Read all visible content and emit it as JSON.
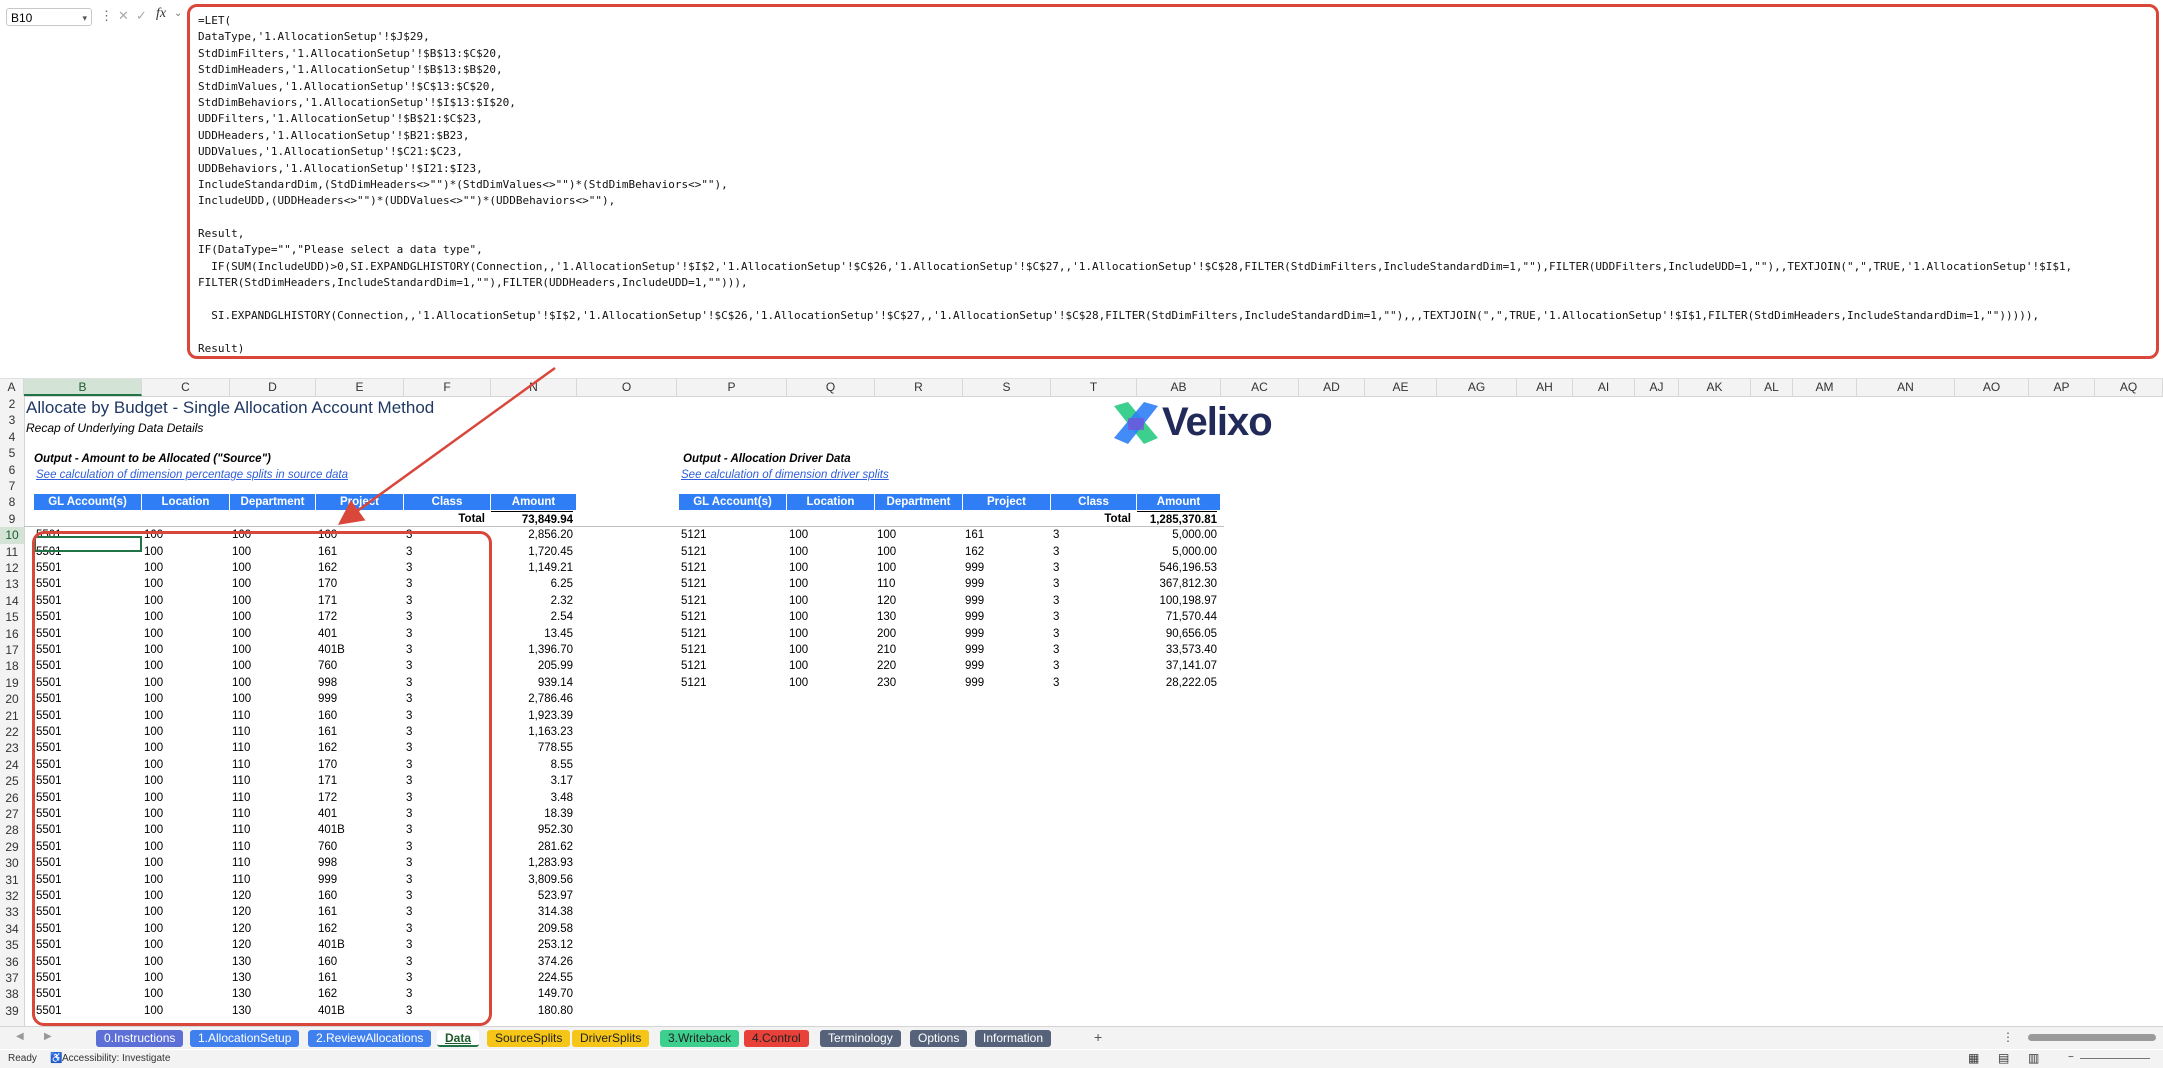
{
  "formula_bar": {
    "name_box": "B10",
    "formula_lines": [
      "=LET(",
      "DataType,'1.AllocationSetup'!$J$29,",
      "StdDimFilters,'1.AllocationSetup'!$B$13:$C$20,",
      "StdDimHeaders,'1.AllocationSetup'!$B$13:$B$20,",
      "StdDimValues,'1.AllocationSetup'!$C$13:$C$20,",
      "StdDimBehaviors,'1.AllocationSetup'!$I$13:$I$20,",
      "UDDFilters,'1.AllocationSetup'!$B$21:$C$23,",
      "UDDHeaders,'1.AllocationSetup'!$B21:$B23,",
      "UDDValues,'1.AllocationSetup'!$C21:$C23,",
      "UDDBehaviors,'1.AllocationSetup'!$I21:$I23,",
      "IncludeStandardDim,(StdDimHeaders<>\"\")*(StdDimValues<>\"\")*(StdDimBehaviors<>\"\"),",
      "IncludeUDD,(UDDHeaders<>\"\")*(UDDValues<>\"\")*(UDDBehaviors<>\"\"),",
      "",
      "Result,",
      "IF(DataType=\"\",\"Please select a data type\",",
      "  IF(SUM(IncludeUDD)>0,SI.EXPANDGLHISTORY(Connection,,'1.AllocationSetup'!$I$2,'1.AllocationSetup'!$C$26,'1.AllocationSetup'!$C$27,,'1.AllocationSetup'!$C$28,FILTER(StdDimFilters,IncludeStandardDim=1,\"\"),FILTER(UDDFilters,IncludeUDD=1,\"\"),,TEXTJOIN(\",\",TRUE,'1.AllocationSetup'!$I$1,",
      "FILTER(StdDimHeaders,IncludeStandardDim=1,\"\"),FILTER(UDDHeaders,IncludeUDD=1,\"\"))),",
      "",
      "  SI.EXPANDGLHISTORY(Connection,,'1.AllocationSetup'!$I$2,'1.AllocationSetup'!$C$26,'1.AllocationSetup'!$C$27,,'1.AllocationSetup'!$C$28,FILTER(StdDimFilters,IncludeStandardDim=1,\"\"),,,TEXTJOIN(\",\",TRUE,'1.AllocationSetup'!$I$1,FILTER(StdDimHeaders,IncludeStandardDim=1,\"\"))))),",
      "",
      "Result)"
    ]
  },
  "columns": [
    "A",
    "B",
    "C",
    "D",
    "E",
    "F",
    "N",
    "O",
    "P",
    "Q",
    "R",
    "S",
    "T",
    "AB",
    "AC",
    "AD",
    "AE",
    "AG",
    "AH",
    "AI",
    "AJ",
    "AK",
    "AL",
    "AM",
    "AN",
    "AO",
    "AP",
    "AQ"
  ],
  "rows": [
    "2",
    "3",
    "4",
    "5",
    "6",
    "7",
    "8",
    "9",
    "10",
    "11",
    "12",
    "13",
    "14",
    "15",
    "16",
    "17",
    "18",
    "19",
    "20",
    "21",
    "22",
    "23",
    "24",
    "25",
    "26",
    "27",
    "28",
    "29",
    "30",
    "31",
    "32",
    "33",
    "34",
    "35",
    "36",
    "37",
    "38",
    "39"
  ],
  "sheet": {
    "title": "Allocate by Budget - Single Allocation Account Method",
    "subtitle": "Recap of Underlying Data Details",
    "logo_text": "Velixo",
    "source": {
      "section_title": "Output - Amount to be Allocated (\"Source\")",
      "link": "See calculation of dimension percentage splits in source data",
      "headers": [
        "GL Account(s)",
        "Location",
        "Department",
        "Project",
        "Class",
        "Amount"
      ],
      "total_label": "Total",
      "total_value": "73,849.94",
      "rows": [
        [
          "5501",
          "100",
          "100",
          "160",
          "3",
          "2,856.20"
        ],
        [
          "5501",
          "100",
          "100",
          "161",
          "3",
          "1,720.45"
        ],
        [
          "5501",
          "100",
          "100",
          "162",
          "3",
          "1,149.21"
        ],
        [
          "5501",
          "100",
          "100",
          "170",
          "3",
          "6.25"
        ],
        [
          "5501",
          "100",
          "100",
          "171",
          "3",
          "2.32"
        ],
        [
          "5501",
          "100",
          "100",
          "172",
          "3",
          "2.54"
        ],
        [
          "5501",
          "100",
          "100",
          "401",
          "3",
          "13.45"
        ],
        [
          "5501",
          "100",
          "100",
          "401B",
          "3",
          "1,396.70"
        ],
        [
          "5501",
          "100",
          "100",
          "760",
          "3",
          "205.99"
        ],
        [
          "5501",
          "100",
          "100",
          "998",
          "3",
          "939.14"
        ],
        [
          "5501",
          "100",
          "100",
          "999",
          "3",
          "2,786.46"
        ],
        [
          "5501",
          "100",
          "110",
          "160",
          "3",
          "1,923.39"
        ],
        [
          "5501",
          "100",
          "110",
          "161",
          "3",
          "1,163.23"
        ],
        [
          "5501",
          "100",
          "110",
          "162",
          "3",
          "778.55"
        ],
        [
          "5501",
          "100",
          "110",
          "170",
          "3",
          "8.55"
        ],
        [
          "5501",
          "100",
          "110",
          "171",
          "3",
          "3.17"
        ],
        [
          "5501",
          "100",
          "110",
          "172",
          "3",
          "3.48"
        ],
        [
          "5501",
          "100",
          "110",
          "401",
          "3",
          "18.39"
        ],
        [
          "5501",
          "100",
          "110",
          "401B",
          "3",
          "952.30"
        ],
        [
          "5501",
          "100",
          "110",
          "760",
          "3",
          "281.62"
        ],
        [
          "5501",
          "100",
          "110",
          "998",
          "3",
          "1,283.93"
        ],
        [
          "5501",
          "100",
          "110",
          "999",
          "3",
          "3,809.56"
        ],
        [
          "5501",
          "100",
          "120",
          "160",
          "3",
          "523.97"
        ],
        [
          "5501",
          "100",
          "120",
          "161",
          "3",
          "314.38"
        ],
        [
          "5501",
          "100",
          "120",
          "162",
          "3",
          "209.58"
        ],
        [
          "5501",
          "100",
          "120",
          "401B",
          "3",
          "253.12"
        ],
        [
          "5501",
          "100",
          "130",
          "160",
          "3",
          "374.26"
        ],
        [
          "5501",
          "100",
          "130",
          "161",
          "3",
          "224.55"
        ],
        [
          "5501",
          "100",
          "130",
          "162",
          "3",
          "149.70"
        ],
        [
          "5501",
          "100",
          "130",
          "401B",
          "3",
          "180.80"
        ]
      ]
    },
    "driver": {
      "section_title": "Output - Allocation Driver Data",
      "link": "See calculation of dimension driver splits",
      "headers": [
        "GL Account(s)",
        "Location",
        "Department",
        "Project",
        "Class",
        "Amount"
      ],
      "total_label": "Total",
      "total_value": "1,285,370.81",
      "rows": [
        [
          "5121",
          "100",
          "100",
          "161",
          "3",
          "5,000.00"
        ],
        [
          "5121",
          "100",
          "100",
          "162",
          "3",
          "5,000.00"
        ],
        [
          "5121",
          "100",
          "100",
          "999",
          "3",
          "546,196.53"
        ],
        [
          "5121",
          "100",
          "110",
          "999",
          "3",
          "367,812.30"
        ],
        [
          "5121",
          "100",
          "120",
          "999",
          "3",
          "100,198.97"
        ],
        [
          "5121",
          "100",
          "130",
          "999",
          "3",
          "71,570.44"
        ],
        [
          "5121",
          "100",
          "200",
          "999",
          "3",
          "90,656.05"
        ],
        [
          "5121",
          "100",
          "210",
          "999",
          "3",
          "33,573.40"
        ],
        [
          "5121",
          "100",
          "220",
          "999",
          "3",
          "37,141.07"
        ],
        [
          "5121",
          "100",
          "230",
          "999",
          "3",
          "28,222.05"
        ]
      ]
    }
  },
  "tabs": [
    {
      "label": "0.Instructions",
      "bg": "#5b6fd6",
      "fg": "#ffffff"
    },
    {
      "label": "1.AllocationSetup",
      "bg": "#3f7fee",
      "fg": "#ffffff"
    },
    {
      "label": "2.ReviewAllocations",
      "bg": "#3f7fee",
      "fg": "#ffffff"
    },
    {
      "label": "Data",
      "bg": "#ffffff",
      "fg": "#1e5b2c",
      "active": true
    },
    {
      "label": "SourceSplits",
      "bg": "#f5c518",
      "fg": "#222222"
    },
    {
      "label": "DriverSplits",
      "bg": "#f5c518",
      "fg": "#222222"
    },
    {
      "label": "3.Writeback",
      "bg": "#3ccf8e",
      "fg": "#222222"
    },
    {
      "label": "4.Control",
      "bg": "#e8413a",
      "fg": "#222222"
    },
    {
      "label": "Terminology",
      "bg": "#55627a",
      "fg": "#ffffff"
    },
    {
      "label": "Options",
      "bg": "#55627a",
      "fg": "#ffffff"
    },
    {
      "label": "Information",
      "bg": "#55627a",
      "fg": "#ffffff"
    }
  ],
  "status": {
    "ready": "Ready",
    "accessibility": "Accessibility: Investigate"
  },
  "colors": {
    "header_blue": "#2f7ef6",
    "annotation_red": "#d9463a",
    "excel_green": "#217346"
  }
}
